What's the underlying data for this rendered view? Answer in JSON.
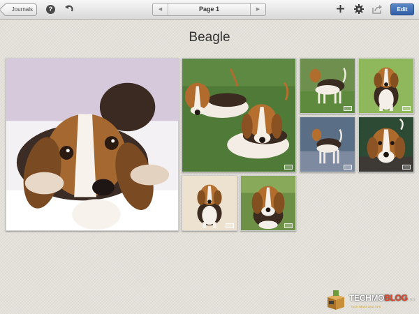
{
  "toolbar": {
    "back_label": "Journals",
    "help_icon": "help-icon",
    "undo_icon": "undo-icon",
    "page_label": "Page 1",
    "prev_icon": "previous-page-icon",
    "next_icon": "next-page-icon",
    "add_icon": "add-icon",
    "settings_icon": "gear-icon",
    "share_icon": "share-icon",
    "edit_label": "Edit",
    "edit_color": "#3b6bb5"
  },
  "page": {
    "title": "Beagle"
  },
  "photos": [
    {
      "subject": "beagle puppy lying on white blanket"
    },
    {
      "subject": "two beagles lying on grass"
    },
    {
      "subject": "beagle standing on grass"
    },
    {
      "subject": "beagle puppy sitting on grass"
    },
    {
      "subject": "beagle standing in profile"
    },
    {
      "subject": "beagle puppy portrait"
    },
    {
      "subject": "beagle puppy sitting on white background"
    },
    {
      "subject": "beagle sitting outdoors"
    }
  ],
  "watermark": {
    "brand_part1": "TECHMO",
    "brand_part2": "BLOG",
    "domain": ".com",
    "tagline": "TECH NEWS AND TIPS"
  }
}
